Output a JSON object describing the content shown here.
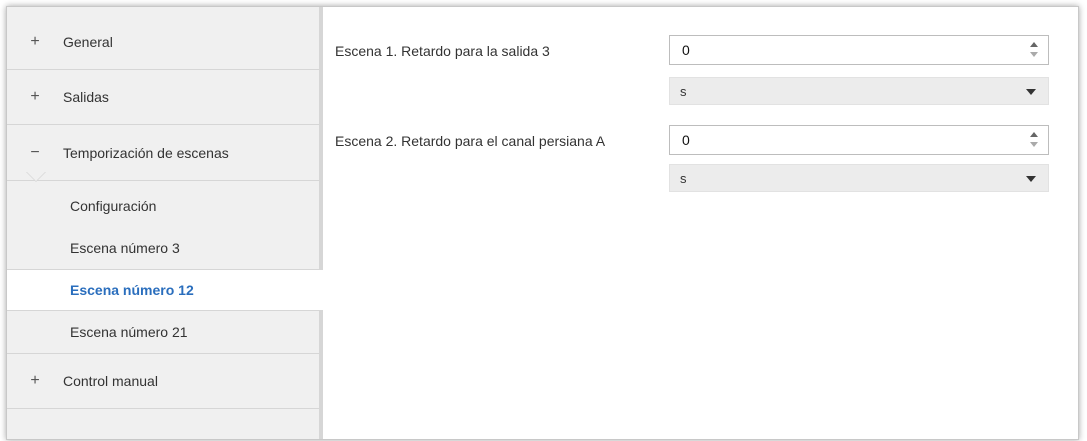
{
  "sidebar": {
    "items": [
      {
        "symbol": "+",
        "label": "General"
      },
      {
        "symbol": "+",
        "label": "Salidas"
      },
      {
        "symbol": "−",
        "label": "Temporización de escenas"
      }
    ],
    "subitems": [
      {
        "label": "Configuración"
      },
      {
        "label": "Escena número 3"
      },
      {
        "label": "Escena número 12"
      },
      {
        "label": "Escena número 21"
      }
    ],
    "active_subitem": "Escena número 12",
    "footer_item": {
      "symbol": "+",
      "label": "Control manual"
    }
  },
  "params": [
    {
      "label": "Escena 1. Retardo para la salida 3",
      "value": "0",
      "unit": "s"
    },
    {
      "label": "Escena 2. Retardo para el canal persiana A",
      "value": "0",
      "unit": "s"
    }
  ],
  "colors": {
    "active_text": "#2a6ebd",
    "sidebar_bg": "#f0f0f0",
    "select_bg": "#ececec"
  }
}
